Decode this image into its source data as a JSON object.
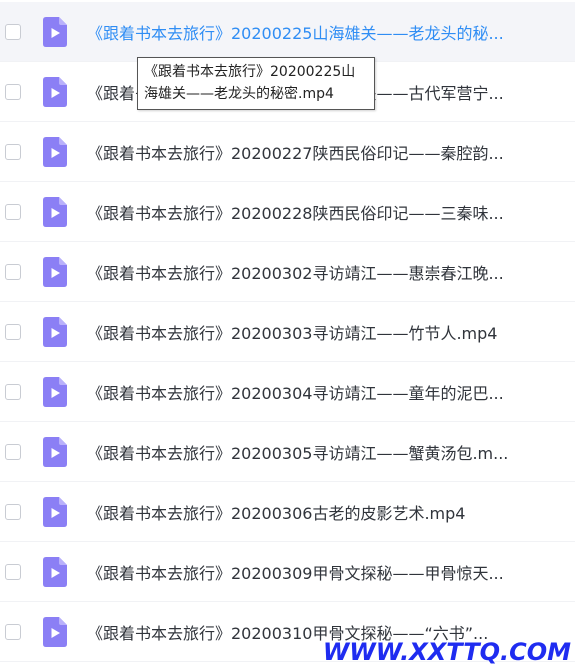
{
  "files": [
    {
      "name": "《跟着书本去旅行》20200225山海雄关——老龙头的秘...",
      "icon": "video-file-icon",
      "hovered": true
    },
    {
      "name": "《跟着书本去旅行》20200226山海雄关——古代军营宁...",
      "icon": "video-file-icon",
      "hovered": false
    },
    {
      "name": "《跟着书本去旅行》20200227陕西民俗印记——秦腔韵...",
      "icon": "video-file-icon",
      "hovered": false
    },
    {
      "name": "《跟着书本去旅行》20200228陕西民俗印记——三秦味...",
      "icon": "video-file-icon",
      "hovered": false
    },
    {
      "name": "《跟着书本去旅行》20200302寻访靖江——惠崇春江晚...",
      "icon": "video-file-icon",
      "hovered": false
    },
    {
      "name": "《跟着书本去旅行》20200303寻访靖江——竹节人.mp4",
      "icon": "video-file-icon",
      "hovered": false
    },
    {
      "name": "《跟着书本去旅行》20200304寻访靖江——童年的泥巴...",
      "icon": "video-file-icon",
      "hovered": false
    },
    {
      "name": "《跟着书本去旅行》20200305寻访靖江——蟹黄汤包.m...",
      "icon": "video-file-icon",
      "hovered": false
    },
    {
      "name": "《跟着书本去旅行》20200306古老的皮影艺术.mp4",
      "icon": "video-file-icon",
      "hovered": false
    },
    {
      "name": "《跟着书本去旅行》20200309甲骨文探秘——甲骨惊天...",
      "icon": "video-file-icon",
      "hovered": false
    },
    {
      "name": "《跟着书本去旅行》20200310甲骨文探秘——“六书”...",
      "icon": "video-file-icon",
      "hovered": false
    }
  ],
  "tooltip": {
    "text": "《跟着书本去旅行》20200225山海雄关——老龙头的秘密.mp4"
  },
  "watermark": {
    "text": "WWW.XXTTQ.COM"
  },
  "colors": {
    "icon_purple": "#8b7ff5",
    "hover_text": "#2f8df4",
    "watermark": "#1f2cf0"
  }
}
